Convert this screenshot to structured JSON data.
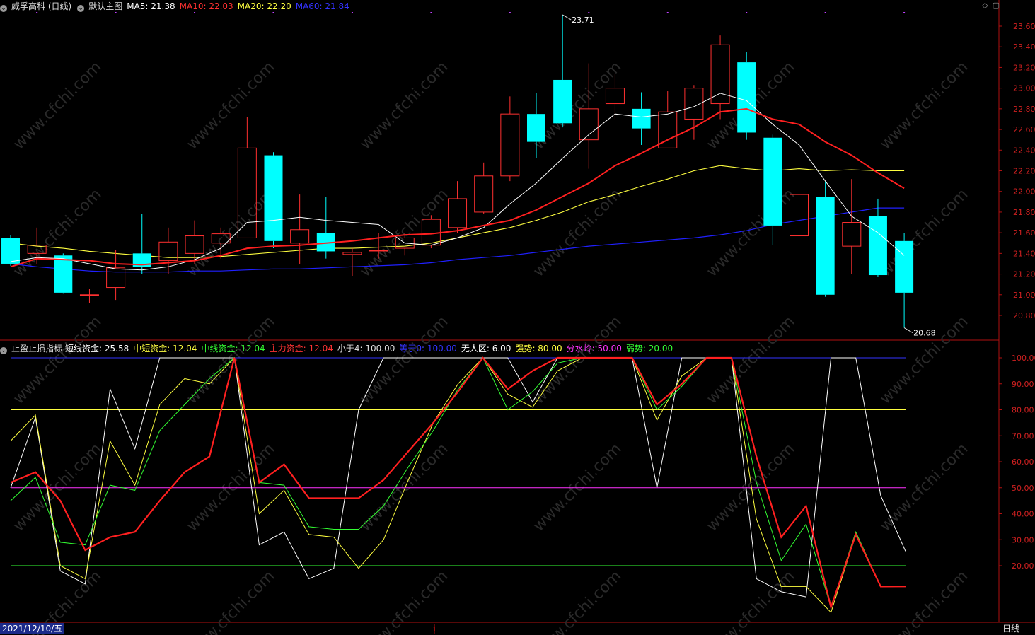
{
  "top_header": {
    "title": "威孚高科 (日线)",
    "main_chart_label": "默认主图",
    "ma5": "MA5: 21.38",
    "ma10": "MA10: 22.03",
    "ma20": "MA20: 22.20",
    "ma60": "MA60: 21.84"
  },
  "bottom_header": {
    "indicator": "止盈止损指标",
    "items": [
      {
        "text": "短线资金: 25.58",
        "color": "#ffffff"
      },
      {
        "text": "中短资金: 12.04",
        "color": "#ffff40"
      },
      {
        "text": "中线资金: 12.04",
        "color": "#33ff33"
      },
      {
        "text": "主力资金: 12.04",
        "color": "#ff3333"
      },
      {
        "text": "小于4: 100.00",
        "color": "#dddddd"
      },
      {
        "text": "等于0: 100.00",
        "color": "#3333ff"
      },
      {
        "text": "无人区: 6.00",
        "color": "#ffffff"
      },
      {
        "text": "强势: 80.00",
        "color": "#ffff40"
      },
      {
        "text": "分水岭: 50.00",
        "color": "#ff33ff"
      },
      {
        "text": "弱势: 20.00",
        "color": "#33ff33"
      }
    ]
  },
  "footer": {
    "date": "2021/12/10/五",
    "period": "日线",
    "marker": "1"
  },
  "chart_data": [
    {
      "type": "candlestick",
      "title": "威孚高科 (日线)",
      "ylim": [
        20.6,
        23.8
      ],
      "y_ticks": [
        "23.60",
        "23.40",
        "23.20",
        "23.00",
        "22.80",
        "22.60",
        "22.40",
        "22.20",
        "22.00",
        "21.80",
        "21.60",
        "21.40",
        "21.20",
        "21.00",
        "20.80"
      ],
      "annotations": [
        {
          "text": "23.71",
          "bar_index": 21,
          "value": 23.71
        },
        {
          "text": "20.68",
          "bar_index": 34,
          "value": 20.68
        }
      ],
      "colors": {
        "up": "#ff3030",
        "down": "#00ffff",
        "ma5": "#ffffff",
        "ma10": "#ff2020",
        "ma20": "#ffff40",
        "ma60": "#2020ff"
      },
      "candles": [
        {
          "o": 21.55,
          "h": 21.58,
          "l": 21.28,
          "c": 21.3
        },
        {
          "o": 21.4,
          "h": 21.65,
          "l": 21.3,
          "c": 21.48
        },
        {
          "o": 21.38,
          "h": 21.4,
          "l": 21.01,
          "c": 21.02
        },
        {
          "o": 21.0,
          "h": 21.06,
          "l": 20.92,
          "c": 21.0
        },
        {
          "o": 21.07,
          "h": 21.43,
          "l": 20.95,
          "c": 21.26
        },
        {
          "o": 21.4,
          "h": 21.78,
          "l": 21.2,
          "c": 21.27
        },
        {
          "o": 21.33,
          "h": 21.65,
          "l": 21.2,
          "c": 21.51
        },
        {
          "o": 21.4,
          "h": 21.72,
          "l": 21.3,
          "c": 21.57
        },
        {
          "o": 21.5,
          "h": 21.65,
          "l": 21.35,
          "c": 21.59
        },
        {
          "o": 21.55,
          "h": 22.72,
          "l": 21.55,
          "c": 22.42
        },
        {
          "o": 22.35,
          "h": 22.38,
          "l": 21.45,
          "c": 21.52
        },
        {
          "o": 21.5,
          "h": 21.97,
          "l": 21.3,
          "c": 21.63
        },
        {
          "o": 21.6,
          "h": 21.95,
          "l": 21.35,
          "c": 21.42
        },
        {
          "o": 21.39,
          "h": 21.45,
          "l": 21.18,
          "c": 21.41
        },
        {
          "o": 21.43,
          "h": 21.6,
          "l": 21.35,
          "c": 21.43
        },
        {
          "o": 21.45,
          "h": 21.6,
          "l": 21.38,
          "c": 21.55
        },
        {
          "o": 21.48,
          "h": 21.77,
          "l": 21.45,
          "c": 21.73
        },
        {
          "o": 21.65,
          "h": 22.1,
          "l": 21.6,
          "c": 21.93
        },
        {
          "o": 21.8,
          "h": 22.28,
          "l": 21.78,
          "c": 22.15
        },
        {
          "o": 22.15,
          "h": 22.92,
          "l": 22.1,
          "c": 22.75
        },
        {
          "o": 22.75,
          "h": 22.95,
          "l": 22.32,
          "c": 22.48
        },
        {
          "o": 23.08,
          "h": 23.71,
          "l": 22.62,
          "c": 22.66
        },
        {
          "o": 22.5,
          "h": 23.24,
          "l": 22.22,
          "c": 22.8
        },
        {
          "o": 22.85,
          "h": 23.14,
          "l": 22.7,
          "c": 23.0
        },
        {
          "o": 22.8,
          "h": 22.96,
          "l": 22.45,
          "c": 22.61
        },
        {
          "o": 22.42,
          "h": 22.97,
          "l": 22.42,
          "c": 22.77
        },
        {
          "o": 22.7,
          "h": 23.03,
          "l": 22.5,
          "c": 23.0
        },
        {
          "o": 22.85,
          "h": 23.51,
          "l": 22.7,
          "c": 23.42
        },
        {
          "o": 23.25,
          "h": 23.35,
          "l": 22.5,
          "c": 22.57
        },
        {
          "o": 22.52,
          "h": 22.55,
          "l": 21.48,
          "c": 21.67
        },
        {
          "o": 21.57,
          "h": 22.35,
          "l": 21.52,
          "c": 21.97
        },
        {
          "o": 21.95,
          "h": 22.1,
          "l": 20.98,
          "c": 21.0
        },
        {
          "o": 21.47,
          "h": 22.12,
          "l": 21.2,
          "c": 21.7
        },
        {
          "o": 21.76,
          "h": 21.93,
          "l": 21.17,
          "c": 21.19
        },
        {
          "o": 21.52,
          "h": 21.6,
          "l": 20.68,
          "c": 21.02
        }
      ],
      "ma5": [
        21.32,
        21.36,
        21.35,
        21.3,
        21.25,
        21.24,
        21.27,
        21.34,
        21.45,
        21.7,
        21.72,
        21.75,
        21.72,
        21.7,
        21.68,
        21.5,
        21.48,
        21.55,
        21.65,
        21.88,
        22.08,
        22.32,
        22.55,
        22.75,
        22.72,
        22.75,
        22.82,
        22.95,
        22.88,
        22.65,
        22.45,
        22.1,
        21.76,
        21.6,
        21.38
      ],
      "ma10": [
        21.27,
        21.35,
        21.34,
        21.33,
        21.3,
        21.29,
        21.31,
        21.33,
        21.38,
        21.45,
        21.47,
        21.48,
        21.5,
        21.52,
        21.55,
        21.58,
        21.59,
        21.62,
        21.67,
        21.72,
        21.82,
        21.95,
        22.08,
        22.25,
        22.37,
        22.5,
        22.62,
        22.77,
        22.8,
        22.7,
        22.65,
        22.48,
        22.35,
        22.18,
        22.03
      ],
      "ma20": [
        21.5,
        21.47,
        21.45,
        21.42,
        21.4,
        21.38,
        21.36,
        21.36,
        21.37,
        21.39,
        21.41,
        21.43,
        21.45,
        21.45,
        21.46,
        21.47,
        21.5,
        21.55,
        21.6,
        21.65,
        21.72,
        21.8,
        21.9,
        21.97,
        22.05,
        22.12,
        22.2,
        22.25,
        22.22,
        22.2,
        22.22,
        22.2,
        22.21,
        22.2,
        22.2
      ],
      "ma60": [
        21.3,
        21.27,
        21.25,
        21.23,
        21.22,
        21.22,
        21.22,
        21.23,
        21.23,
        21.24,
        21.25,
        21.25,
        21.26,
        21.27,
        21.28,
        21.29,
        21.31,
        21.34,
        21.36,
        21.38,
        21.41,
        21.44,
        21.47,
        21.49,
        21.51,
        21.53,
        21.55,
        21.58,
        21.62,
        21.68,
        21.72,
        21.76,
        21.8,
        21.84,
        21.84
      ]
    },
    {
      "type": "line",
      "title": "止盈止损指标",
      "ylim": [
        0,
        100
      ],
      "y_ticks": [
        "100.00",
        "90.00",
        "80.00",
        "70.00",
        "60.00",
        "50.00",
        "40.00",
        "30.00",
        "20.00"
      ],
      "hlines": [
        {
          "value": 100,
          "color": "#3333ff"
        },
        {
          "value": 80,
          "color": "#ffff40"
        },
        {
          "value": 50,
          "color": "#ff33ff"
        },
        {
          "value": 20,
          "color": "#33ff33"
        },
        {
          "value": 6,
          "color": "#ffffff"
        }
      ],
      "series": [
        {
          "name": "短线资金",
          "color": "#ffffff",
          "width": 1,
          "values": [
            50,
            77,
            18,
            13,
            88,
            65,
            100,
            100,
            100,
            100,
            28,
            33,
            15,
            19,
            80,
            100,
            100,
            100,
            100,
            100,
            100,
            83,
            100,
            100,
            100,
            100,
            50,
            100,
            100,
            100,
            15,
            10,
            8,
            100,
            100,
            47,
            25.58
          ]
        },
        {
          "name": "中短资金",
          "color": "#ffff40",
          "width": 1,
          "values": [
            68,
            78,
            20,
            15,
            68,
            51,
            82,
            92,
            90,
            100,
            40,
            49,
            32,
            31,
            19,
            30,
            53,
            75,
            90,
            100,
            86,
            81,
            95,
            100,
            100,
            100,
            76,
            93,
            100,
            100,
            38,
            12,
            12,
            2,
            32,
            12,
            12.04
          ]
        },
        {
          "name": "中线资金",
          "color": "#33ff33",
          "width": 1,
          "values": [
            45,
            54,
            29,
            28,
            51,
            49,
            72,
            82,
            92,
            100,
            52,
            51,
            35,
            34,
            34,
            43,
            58,
            72,
            88,
            100,
            80,
            87,
            98,
            100,
            100,
            100,
            80,
            89,
            100,
            100,
            52,
            22,
            36,
            4,
            33,
            12,
            12.04
          ]
        },
        {
          "name": "主力资金",
          "color": "#ff2020",
          "width": 2.2,
          "values": [
            52,
            56,
            45,
            26,
            31,
            33,
            45,
            56,
            62,
            100,
            52,
            59,
            46,
            46,
            46,
            53,
            64,
            75,
            87,
            100,
            88,
            95,
            100,
            100,
            100,
            100,
            82,
            90,
            100,
            100,
            62,
            31,
            43,
            4,
            32,
            12,
            12.04
          ]
        }
      ]
    }
  ]
}
